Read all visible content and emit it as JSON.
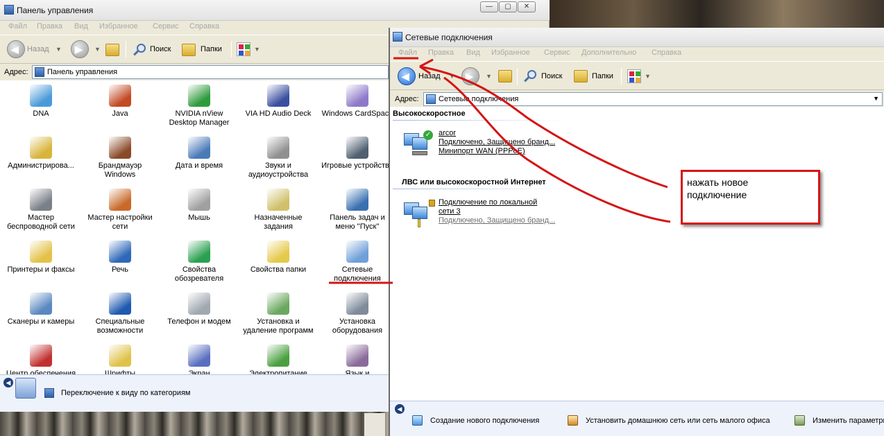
{
  "control_panel": {
    "title": "Панель управления",
    "menu": [
      "Файл",
      "Правка",
      "Вид",
      "Избранное",
      "Сервис",
      "Справка"
    ],
    "toolbar": {
      "back": "Назад",
      "search": "Поиск",
      "folders": "Папки"
    },
    "address_label": "Адрес:",
    "address_value": "Панель управления",
    "items": [
      {
        "label": "DNA",
        "icon": "dna-icon"
      },
      {
        "label": "Java",
        "icon": "java-icon"
      },
      {
        "label": "NVIDIA nView\nDesktop Manager",
        "icon": "nvidia-icon"
      },
      {
        "label": "VIA HD Audio Deck",
        "icon": "via-audio-icon"
      },
      {
        "label": "Windows CardSpace",
        "icon": "cardspace-icon"
      },
      {
        "label": "Администрирова...",
        "icon": "admin-tools-icon"
      },
      {
        "label": "Брандмауэр\nWindows",
        "icon": "firewall-icon"
      },
      {
        "label": "Дата и время",
        "icon": "date-time-icon"
      },
      {
        "label": "Звуки и\nаудиоустройства",
        "icon": "sounds-icon"
      },
      {
        "label": "Игровые устройства",
        "icon": "game-controller-icon"
      },
      {
        "label": "Мастер\nбеспроводной сети",
        "icon": "wireless-wizard-icon"
      },
      {
        "label": "Мастер настройки\nсети",
        "icon": "network-wizard-icon"
      },
      {
        "label": "Мышь",
        "icon": "mouse-icon"
      },
      {
        "label": "Назначенные\nзадания",
        "icon": "scheduled-tasks-icon"
      },
      {
        "label": "Панель задач и\nменю ''Пуск''",
        "icon": "taskbar-start-icon"
      },
      {
        "label": "Принтеры и факсы",
        "icon": "printers-icon"
      },
      {
        "label": "Речь",
        "icon": "speech-icon"
      },
      {
        "label": "Свойства\nобозревателя",
        "icon": "internet-options-icon"
      },
      {
        "label": "Свойства папки",
        "icon": "folder-options-icon"
      },
      {
        "label": "Сетевые\nподключения",
        "icon": "network-connections-icon"
      },
      {
        "label": "Сканеры и камеры",
        "icon": "scanners-icon"
      },
      {
        "label": "Специальные\nвозможности",
        "icon": "accessibility-icon"
      },
      {
        "label": "Телефон и модем",
        "icon": "phone-modem-icon"
      },
      {
        "label": "Установка и\nудаление программ",
        "icon": "add-remove-icon"
      },
      {
        "label": "Установка\nоборудования",
        "icon": "add-hardware-icon"
      },
      {
        "label": "Центр обеспечения",
        "icon": "security-center-icon"
      },
      {
        "label": "Шрифты",
        "icon": "fonts-icon"
      },
      {
        "label": "Экран",
        "icon": "display-icon"
      },
      {
        "label": "Электропитание",
        "icon": "power-icon"
      },
      {
        "label": "Язык и",
        "icon": "language-icon"
      }
    ],
    "bottom_link": "Переключение к виду по категориям"
  },
  "network": {
    "title": "Сетевые подключения",
    "menu": [
      "Файл",
      "Правка",
      "Вид",
      "Избранное",
      "Сервис",
      "Дополнительно",
      "Справка"
    ],
    "toolbar": {
      "back": "Назад",
      "search": "Поиск",
      "folders": "Папки"
    },
    "address_label": "Адрес:",
    "address_value": "Сетевые подключения",
    "groups": [
      {
        "heading": "Высокоскоростное",
        "connections": [
          {
            "name": "arcor",
            "line1": "Подключено, Защищено бранд...",
            "line2": "Минипорт WAN (PPPoE)"
          }
        ]
      },
      {
        "heading": "ЛВС или высокоскоростной Интернет",
        "connections": [
          {
            "name": "Подключение по локальной",
            "line1": "сети 3",
            "line2": "Подключено, Защищено бранд..."
          }
        ]
      }
    ],
    "tasks": [
      "Создание нового подключения",
      "Установить домашнюю сеть или сеть малого офиса",
      "Изменить параметры"
    ]
  },
  "annotation": {
    "text": "нажать новое\nподключение",
    "color": "#d51515"
  }
}
